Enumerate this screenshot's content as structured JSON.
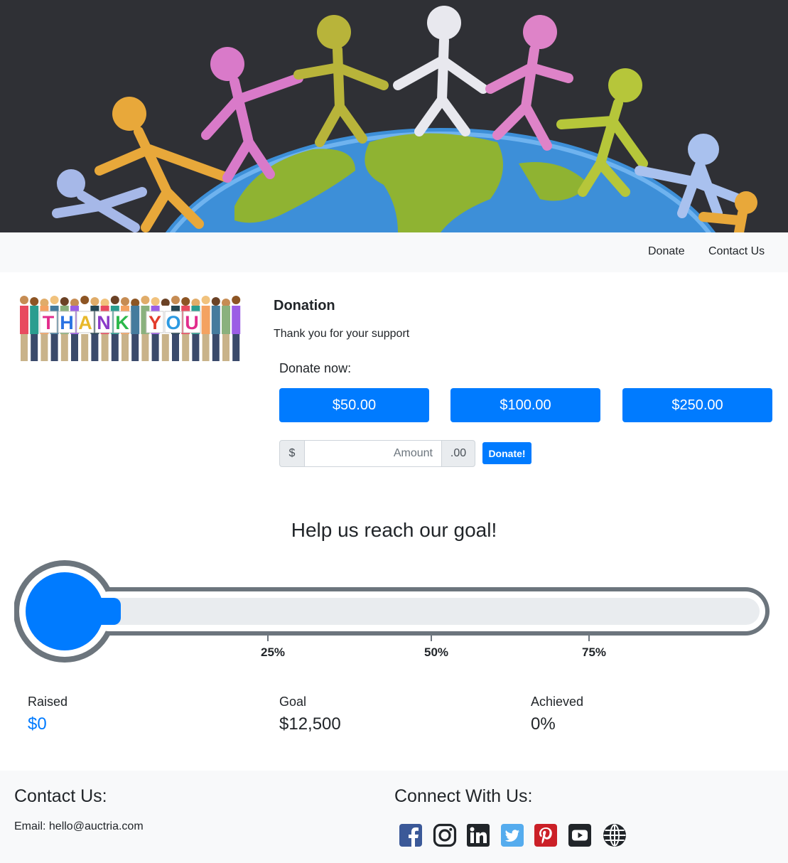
{
  "nav": {
    "donate_label": "Donate",
    "contact_label": "Contact Us"
  },
  "donation": {
    "title": "Donation",
    "subtitle": "Thank you for your support",
    "donate_now_label": "Donate now:",
    "amounts": [
      "$50.00",
      "$100.00",
      "$250.00"
    ],
    "currency_prefix": "$",
    "amount_placeholder": "Amount",
    "cents_suffix": ".00",
    "submit_label": "Donate!"
  },
  "thanks_image_text": "THANK YOU",
  "goal": {
    "heading": "Help us reach our goal!",
    "progress_fraction": 0,
    "ticks": [
      "25%",
      "50%",
      "75%"
    ],
    "raised_label": "Raised",
    "raised_value": "$0",
    "goal_label": "Goal",
    "goal_value": "$12,500",
    "achieved_label": "Achieved",
    "achieved_value": "0%"
  },
  "footer": {
    "contact_heading": "Contact Us:",
    "email_text": "Email: hello@auctria.com",
    "connect_heading": "Connect With Us:",
    "social_icons": [
      "facebook-icon",
      "instagram-icon",
      "linkedin-icon",
      "twitter-icon",
      "pinterest-icon",
      "youtube-icon",
      "globe-icon"
    ]
  },
  "colors": {
    "primary": "#007bff",
    "thermometer_outline": "#6c757d",
    "thermometer_track": "#e9ecef",
    "facebook": "#3b5998",
    "twitter": "#55acee",
    "pinterest": "#cb2027"
  }
}
